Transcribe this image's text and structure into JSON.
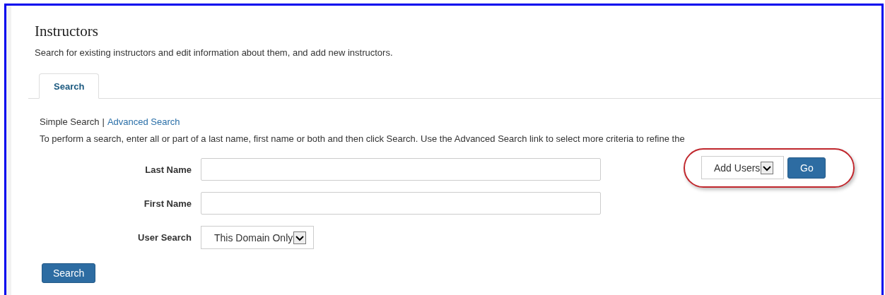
{
  "page": {
    "title": "Instructors",
    "description": "Search for existing instructors and edit information about them, and add new instructors."
  },
  "tabs": [
    {
      "label": "Search",
      "selected": true
    }
  ],
  "search_modes": [
    {
      "label": "Simple Search",
      "selected": true
    },
    {
      "label": "Advanced Search",
      "selected": false
    }
  ],
  "mode_separator": "|",
  "instructions": "To perform a search, enter all or part of a last name, first name or both and then click Search. Use the Advanced Search link to select more criteria to refine the",
  "fields": [
    {
      "label": "Last Name",
      "kind": "text"
    },
    {
      "label": "First Name",
      "kind": "text"
    },
    {
      "label": "User Search",
      "kind": "select",
      "value": "This Domain Only"
    }
  ],
  "actions": {
    "select": "Add Users",
    "button": "Go",
    "highlighted": true
  },
  "search_button": "Search"
}
